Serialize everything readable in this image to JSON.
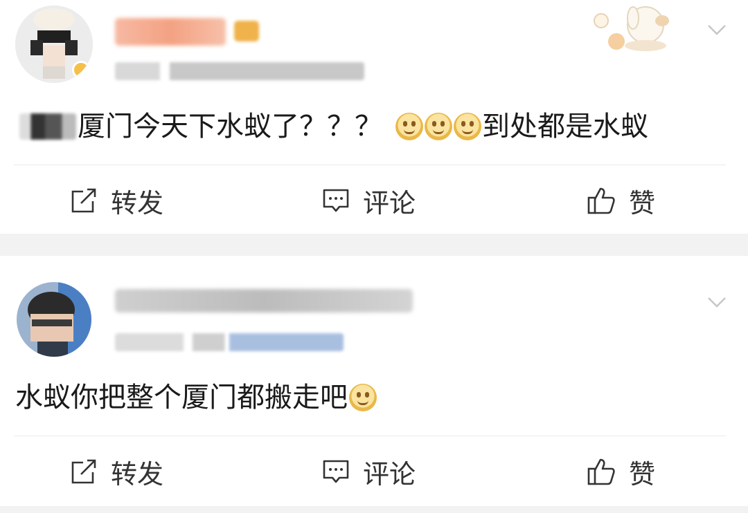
{
  "posts": [
    {
      "text": "厦门今天下水蚁了？？？",
      "text_after": "到处都是水蚁",
      "actions": {
        "repost": "转发",
        "comment": "评论",
        "like": "赞"
      }
    },
    {
      "text": "水蚁你把整个厦门都搬走吧",
      "actions": {
        "repost": "转发",
        "comment": "评论",
        "like": "赞"
      }
    }
  ],
  "icons": {
    "repost": "repost-icon",
    "comment": "comment-icon",
    "like": "thumbs-up-icon",
    "menu": "chevron-down-icon",
    "emoji": "smiling-face-emoji"
  },
  "colors": {
    "accent_username": "#f08a5d",
    "muted": "#999999",
    "text": "#1a1a1a"
  }
}
